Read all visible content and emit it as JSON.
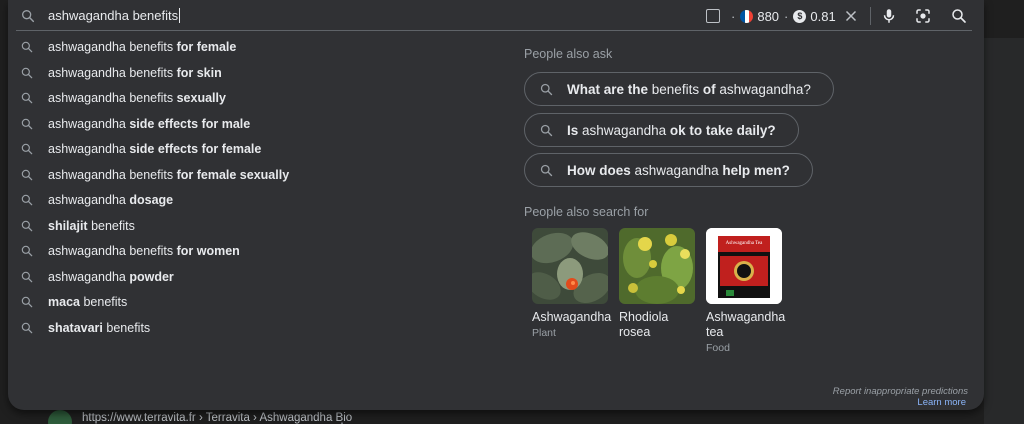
{
  "search": {
    "query": "ashwagandha benefits",
    "extension": {
      "country_flag": "France",
      "count": "880",
      "cost": "0.81",
      "separator": "·"
    }
  },
  "suggestions": [
    {
      "plain": "ashwagandha benefits",
      "bold": "for female"
    },
    {
      "plain": "ashwagandha benefits",
      "bold": "for skin"
    },
    {
      "plain": "ashwagandha benefits",
      "bold": "sexually"
    },
    {
      "plain": "ashwagandha",
      "bold": "side effects for male"
    },
    {
      "plain": "ashwagandha",
      "bold": "side effects for female"
    },
    {
      "plain": "ashwagandha benefits",
      "bold": "for female sexually"
    },
    {
      "plain": "ashwagandha",
      "bold": "dosage"
    },
    {
      "bold_first": "shilajit",
      "plain_after": "benefits"
    },
    {
      "plain": "ashwagandha benefits",
      "bold": "for women"
    },
    {
      "plain": "ashwagandha",
      "bold": "powder"
    },
    {
      "bold_first": "maca",
      "plain_after": "benefits"
    },
    {
      "bold_first": "shatavari",
      "plain_after": "benefits"
    }
  ],
  "people_also_ask": {
    "title": "People also ask",
    "questions": [
      {
        "b1": "What are the",
        "p1": "benefits",
        "b2": "of",
        "p2": "ashwagandha?"
      },
      {
        "b1": "Is",
        "p1": "ashwagandha",
        "b2": "ok to take daily?"
      },
      {
        "b1": "How does",
        "p1": "ashwagandha",
        "b2": "help men?"
      }
    ]
  },
  "people_also_search": {
    "title": "People also search for",
    "items": [
      {
        "title": "Ashwagandha",
        "subtitle": "Plant"
      },
      {
        "title": "Rhodiola rosea",
        "subtitle": ""
      },
      {
        "title": "Ashwagandha tea",
        "subtitle": "Food",
        "box_label": "Ashwagandha Tea"
      }
    ]
  },
  "footer": {
    "report": "Report inappropriate predictions",
    "learn_more": "Learn more"
  },
  "behind": {
    "url": "https://www.terravita.fr › Terravita › Ashwagandha Bio"
  },
  "colors": {
    "panel": "#303134",
    "text": "#e8eaed",
    "muted": "#9aa0a6",
    "link": "#8ab4f8",
    "border": "#5f6368"
  }
}
